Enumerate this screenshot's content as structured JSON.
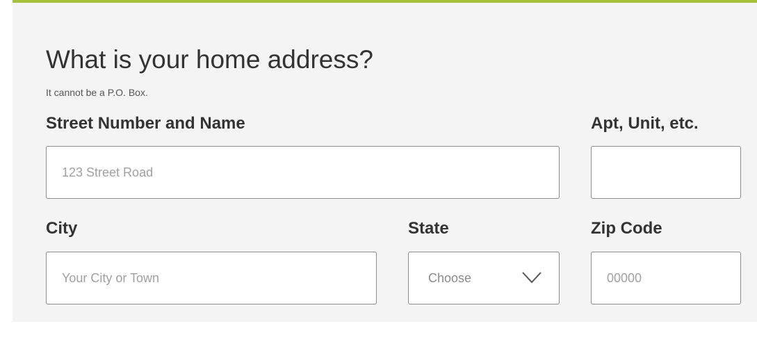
{
  "form": {
    "title": "What is your home address?",
    "subtitle": "It cannot be a P.O. Box.",
    "street": {
      "label": "Street Number and Name",
      "placeholder": "123 Street Road",
      "value": ""
    },
    "apt": {
      "label": "Apt, Unit, etc.",
      "placeholder": "",
      "value": ""
    },
    "city": {
      "label": "City",
      "placeholder": "Your City or Town",
      "value": ""
    },
    "state": {
      "label": "State",
      "selected": "Choose",
      "icon": "chevron-down-icon"
    },
    "zip": {
      "label": "Zip Code",
      "placeholder": "00000",
      "value": ""
    }
  },
  "colors": {
    "accent": "#a6c13a",
    "panel_background": "#f4f4f4",
    "field_border": "#8c8c8c",
    "text": "#333333"
  }
}
